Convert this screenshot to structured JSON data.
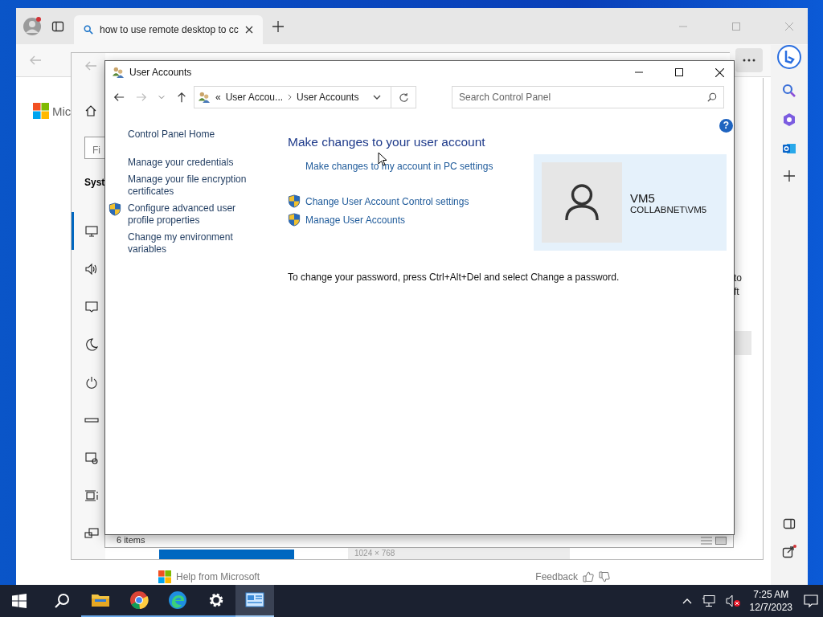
{
  "browser": {
    "tabs": [
      {
        "title": "how to use remote desktop to cc",
        "selected": true
      }
    ],
    "page": {
      "logo_text": "Mic",
      "help_link": "Help from Microsoft",
      "feedback": "Feedback"
    }
  },
  "settings_window": {
    "search_placeholder": "Fi",
    "heading": "Syst",
    "nav": [
      {
        "kind": "display",
        "selected": true
      },
      {
        "kind": "sound",
        "selected": false
      },
      {
        "kind": "notifications",
        "selected": false
      },
      {
        "kind": "focus",
        "selected": false
      },
      {
        "kind": "power",
        "selected": false
      },
      {
        "kind": "storage",
        "selected": false
      },
      {
        "kind": "tablet",
        "selected": false
      },
      {
        "kind": "multitasking",
        "selected": false
      },
      {
        "kind": "projecting",
        "selected": false
      }
    ],
    "side_text": [
      "to",
      "ft"
    ],
    "resolution": "1024 × 768"
  },
  "explorer_status": "6 items",
  "control_panel": {
    "title": "User Accounts",
    "breadcrumb_start": "«",
    "breadcrumb": [
      "User Accou...",
      "User Accounts"
    ],
    "search": {
      "placeholder": "Search Control Panel"
    },
    "help_label": "?",
    "sidebar": [
      {
        "label": "Control Panel Home",
        "shield": false
      },
      {
        "label": "Manage your credentials",
        "shield": false
      },
      {
        "label": "Manage your file encryption certificates",
        "shield": false
      },
      {
        "label": "Configure advanced user profile properties",
        "shield": true
      },
      {
        "label": "Change my environment variables",
        "shield": false
      }
    ],
    "heading": "Make changes to your user account",
    "links": [
      {
        "label": "Make changes to my account in PC settings",
        "shield": false
      },
      {
        "label": "Change User Account Control settings",
        "shield": true
      },
      {
        "label": "Manage User Accounts",
        "shield": true
      }
    ],
    "user": {
      "name": "VM5",
      "account": "COLLABNET\\VM5"
    },
    "note": "To change your password, press Ctrl+Alt+Del and select Change a password."
  },
  "taskbar": {
    "apps": [
      {
        "kind": "explorer",
        "selected": false
      },
      {
        "kind": "chrome",
        "selected": false
      },
      {
        "kind": "edge",
        "selected": false
      },
      {
        "kind": "settings",
        "selected": false
      },
      {
        "kind": "control-panel",
        "selected": true
      }
    ],
    "clock": {
      "time": "7:25 AM",
      "date": "12/7/2023"
    }
  }
}
